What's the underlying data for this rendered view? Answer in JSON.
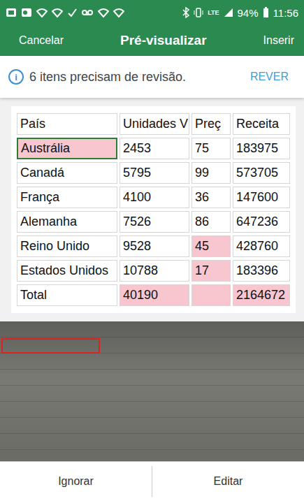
{
  "status_bar": {
    "network": "LTE",
    "battery": "94%",
    "time": "11:56"
  },
  "header": {
    "cancel": "Cancelar",
    "title": "Pré-visualizar",
    "insert": "Inserir"
  },
  "banner": {
    "icon": "i",
    "message": "6 itens precisam de revisão.",
    "action": "REVER"
  },
  "table": {
    "columns": [
      {
        "text": "País"
      },
      {
        "text": "Unidades V"
      },
      {
        "text": "Preç"
      },
      {
        "text": "Receita"
      }
    ],
    "rows": [
      {
        "cells": [
          {
            "text": "Austrália",
            "flagged": true,
            "selected": true
          },
          {
            "text": "2453",
            "flagged": false,
            "selected": false
          },
          {
            "text": "75",
            "flagged": false,
            "selected": false
          },
          {
            "text": "183975",
            "flagged": false,
            "selected": false
          }
        ]
      },
      {
        "cells": [
          {
            "text": "Canadá",
            "flagged": false,
            "selected": false
          },
          {
            "text": "5795",
            "flagged": false,
            "selected": false
          },
          {
            "text": "99",
            "flagged": false,
            "selected": false
          },
          {
            "text": "573705",
            "flagged": false,
            "selected": false
          }
        ]
      },
      {
        "cells": [
          {
            "text": "França",
            "flagged": false,
            "selected": false
          },
          {
            "text": "4100",
            "flagged": false,
            "selected": false
          },
          {
            "text": "36",
            "flagged": false,
            "selected": false
          },
          {
            "text": "147600",
            "flagged": false,
            "selected": false
          }
        ]
      },
      {
        "cells": [
          {
            "text": "Alemanha",
            "flagged": false,
            "selected": false
          },
          {
            "text": "7526",
            "flagged": false,
            "selected": false
          },
          {
            "text": "86",
            "flagged": false,
            "selected": false
          },
          {
            "text": "647236",
            "flagged": false,
            "selected": false
          }
        ]
      },
      {
        "cells": [
          {
            "text": "Reino Unido",
            "flagged": false,
            "selected": false
          },
          {
            "text": "9528",
            "flagged": false,
            "selected": false
          },
          {
            "text": "45",
            "flagged": true,
            "selected": false
          },
          {
            "text": "428760",
            "flagged": false,
            "selected": false
          }
        ]
      },
      {
        "cells": [
          {
            "text": "Estados Unidos",
            "flagged": false,
            "selected": false
          },
          {
            "text": "10788",
            "flagged": false,
            "selected": false
          },
          {
            "text": "17",
            "flagged": true,
            "selected": false
          },
          {
            "text": "183396",
            "flagged": false,
            "selected": false
          }
        ]
      },
      {
        "cells": [
          {
            "text": "Total",
            "flagged": false,
            "selected": false
          },
          {
            "text": "40190",
            "flagged": true,
            "selected": false
          },
          {
            "text": "",
            "flagged": true,
            "selected": false
          },
          {
            "text": "2164672",
            "flagged": true,
            "selected": false
          }
        ]
      }
    ]
  },
  "buttons": [
    {
      "label": "Ignorar"
    },
    {
      "label": "Editar"
    }
  ]
}
